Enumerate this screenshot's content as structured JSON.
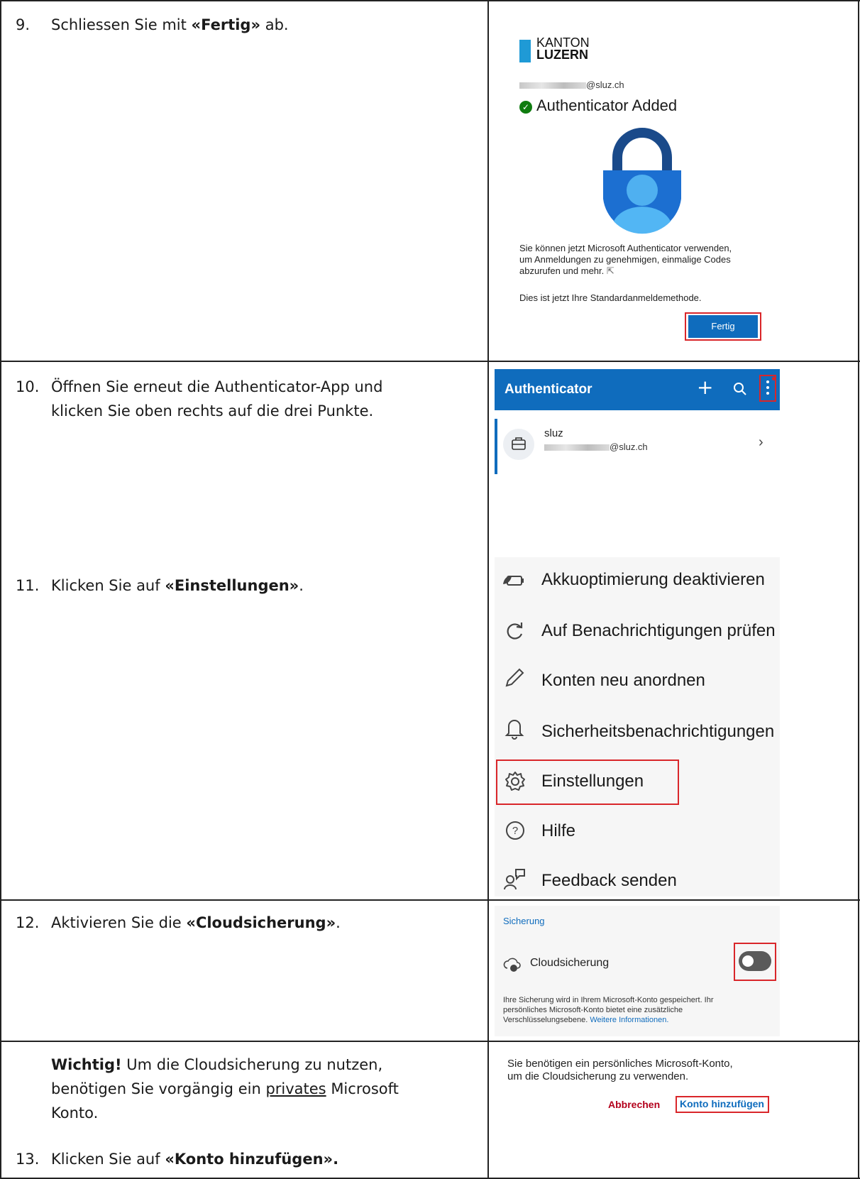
{
  "step9": {
    "num": "9.",
    "pre": "Schliessen Sie mit ",
    "bold": "«Fertig»",
    "post": " ab."
  },
  "shot9": {
    "logo_line1": "KANTON",
    "logo_line2": "LUZERN",
    "email": "@sluz.ch",
    "title": "Authenticator Added",
    "body_line1": "Sie können jetzt Microsoft Authenticator verwenden,",
    "body_line2": "um Anmeldungen zu genehmigen, einmalige Codes",
    "body_line3": "abzurufen und mehr.",
    "default_text": "Dies ist jetzt Ihre Standardanmeldemethode.",
    "done_button": "Fertig"
  },
  "step10": {
    "num": "10.",
    "line1": "Öffnen Sie erneut die Authenticator-App und",
    "line2": "klicken Sie oben rechts auf die drei Punkte."
  },
  "shot10": {
    "app_title": "Authenticator",
    "account_name": "sluz",
    "account_email": "@sluz.ch",
    "accent": "#0f6cbd"
  },
  "step11": {
    "num": "11.",
    "pre": "Klicken Sie auf ",
    "bold": "«Einstellungen»",
    "post": "."
  },
  "shot11": {
    "menu": [
      {
        "icon": "battery-leaf-icon",
        "label": "Akkuoptimierung deaktivieren"
      },
      {
        "icon": "refresh-icon",
        "label": "Auf Benachrichtigungen prüfen"
      },
      {
        "icon": "pencil-icon",
        "label": "Konten neu anordnen"
      },
      {
        "icon": "bell-icon",
        "label": "Sicherheitsbenachrichtigungen"
      },
      {
        "icon": "gear-icon",
        "label": "Einstellungen"
      },
      {
        "icon": "help-icon",
        "label": "Hilfe"
      },
      {
        "icon": "feedback-icon",
        "label": "Feedback senden"
      }
    ]
  },
  "step12": {
    "num": "12.",
    "pre": "Aktivieren Sie die ",
    "bold": "«Cloudsicherung»",
    "post": "."
  },
  "shot12": {
    "section": "Sicherung",
    "toggle_label": "Cloudsicherung",
    "toggle_on": false,
    "info_line1": "Ihre Sicherung wird in Ihrem Microsoft-Konto gespeichert. Ihr",
    "info_line2": "persönliches Microsoft-Konto bietet eine zusätzliche",
    "info_line3": "Verschlüsselungsebene.",
    "info_link": "Weitere Informationen."
  },
  "important": {
    "bold": "Wichtig!",
    "line1": " Um die Cloudsicherung zu nutzen,",
    "line2_pre": "benötigen Sie vorgängig ein ",
    "line2_underline": "privates",
    "line2_post": " Microsoft",
    "line3": "Konto."
  },
  "step13": {
    "num": "13.",
    "pre": "Klicken Sie auf ",
    "bold": "«Konto hinzufügen»."
  },
  "shot13": {
    "line1": "Sie benötigen ein persönliches Microsoft-Konto,",
    "line2": "um die Cloudsicherung zu verwenden.",
    "cancel": "Abbrechen",
    "add": "Konto hinzufügen"
  }
}
